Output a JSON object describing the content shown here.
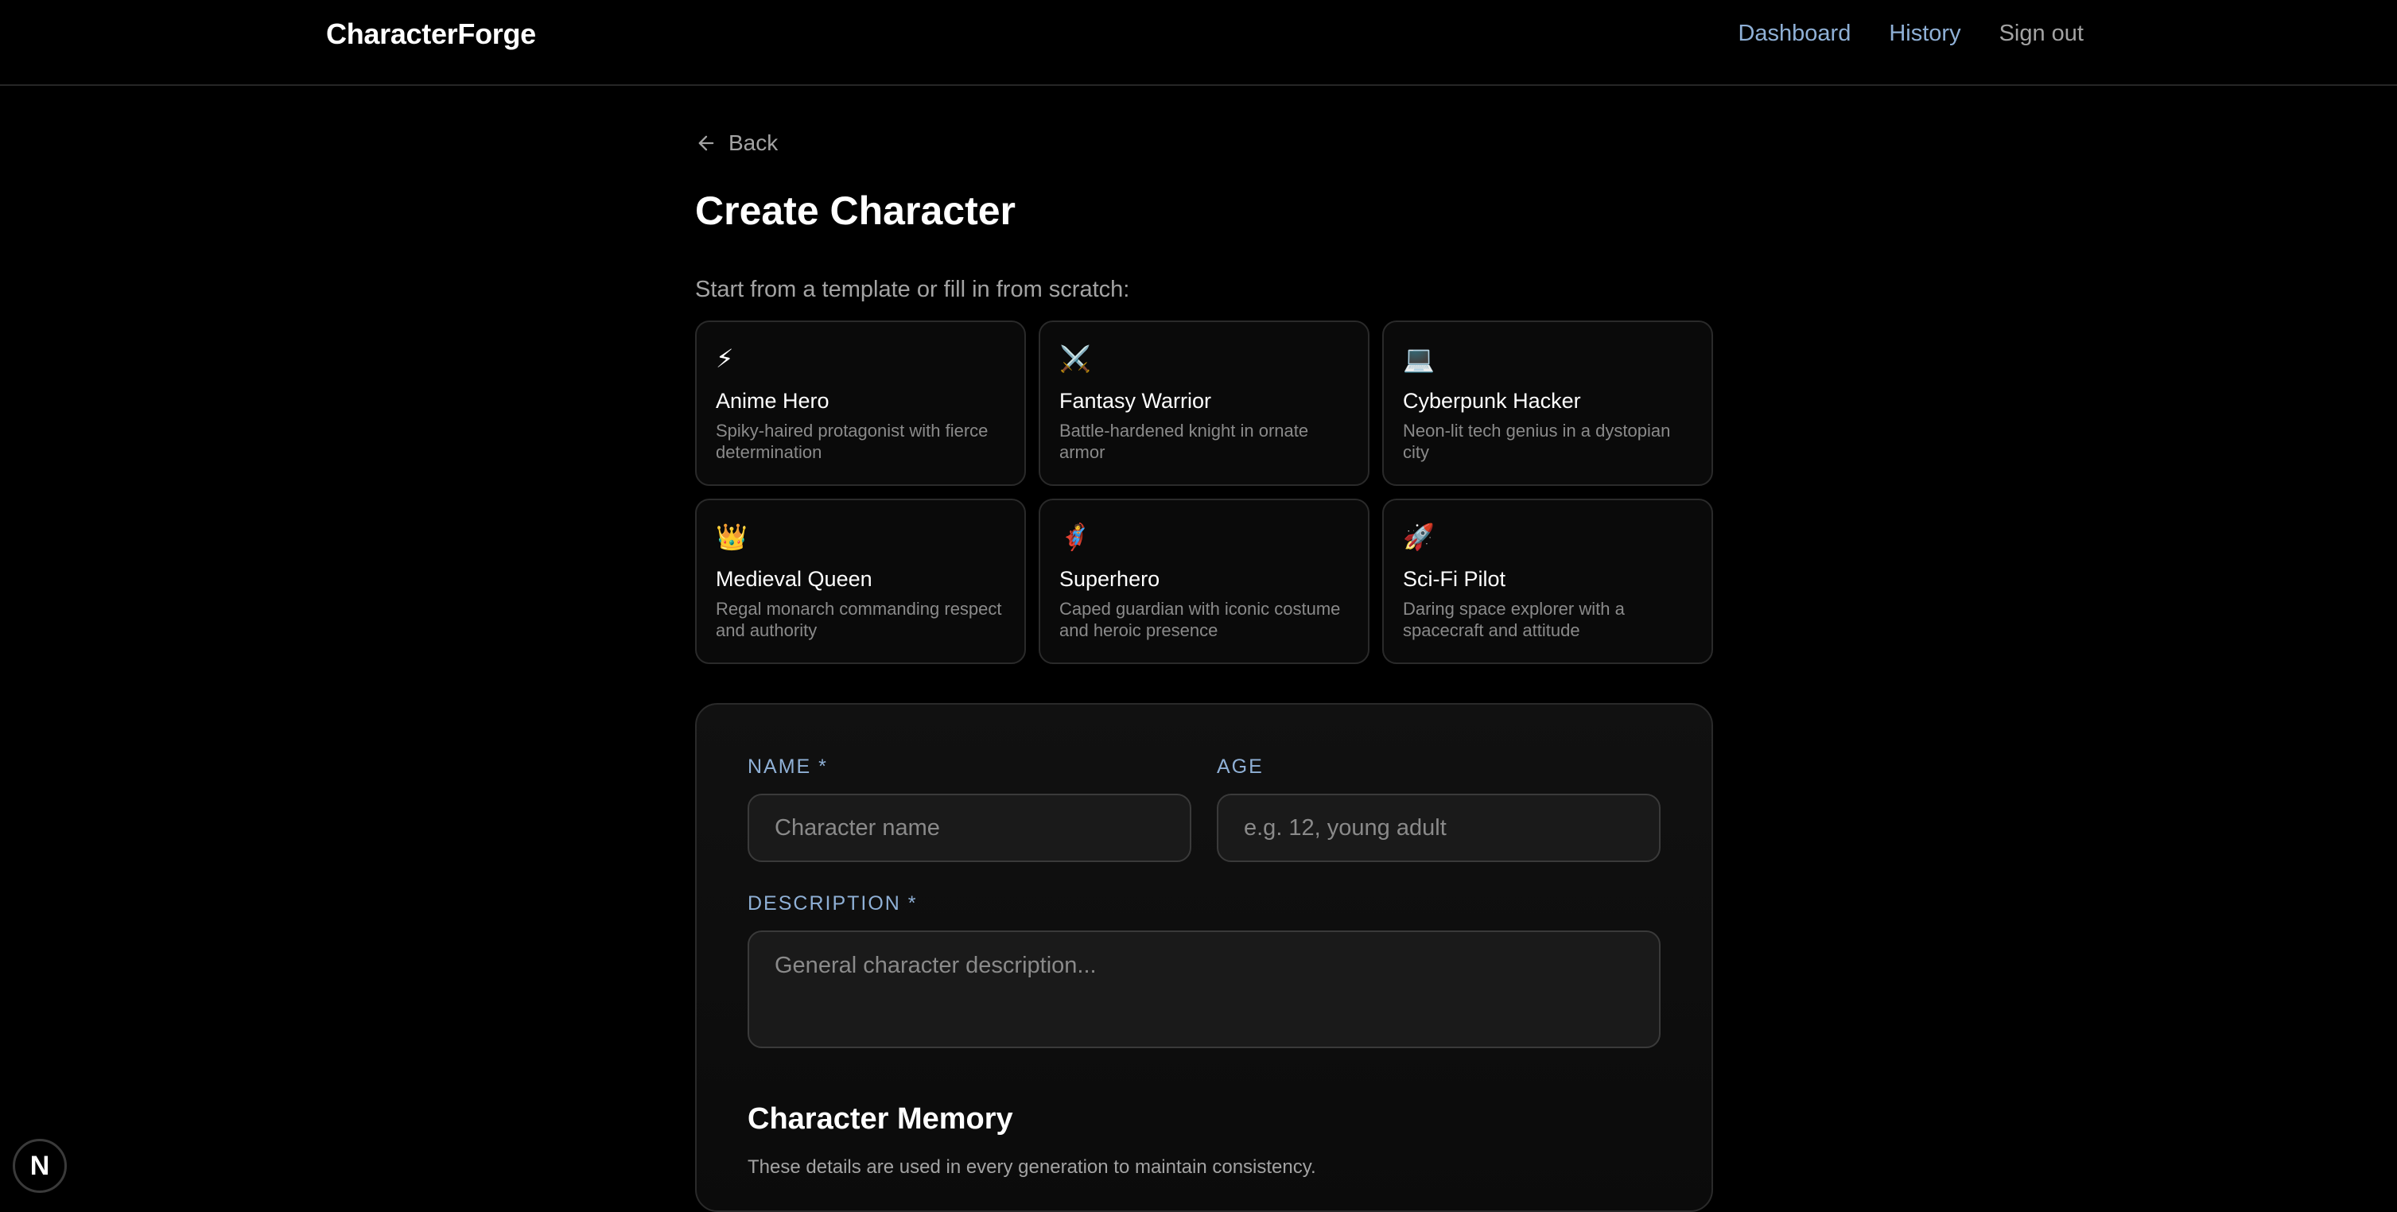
{
  "header": {
    "brand": "CharacterForge",
    "nav": [
      "Dashboard",
      "History",
      "Sign out"
    ]
  },
  "page": {
    "back_label": "Back",
    "title": "Create Character",
    "template_prompt": "Start from a template or fill in from scratch:"
  },
  "templates": [
    {
      "icon": "⚡",
      "icon_name": "lightning-icon",
      "name": "Anime Hero",
      "desc": "Spiky-haired protagonist with fierce determination"
    },
    {
      "icon": "⚔️",
      "icon_name": "crossed-swords-icon",
      "name": "Fantasy Warrior",
      "desc": "Battle-hardened knight in ornate armor"
    },
    {
      "icon": "💻",
      "icon_name": "laptop-icon",
      "name": "Cyberpunk Hacker",
      "desc": "Neon-lit tech genius in a dystopian city"
    },
    {
      "icon": "👑",
      "icon_name": "crown-icon",
      "name": "Medieval Queen",
      "desc": "Regal monarch commanding respect and authority"
    },
    {
      "icon": "🦸",
      "icon_name": "superhero-icon",
      "name": "Superhero",
      "desc": "Caped guardian with iconic costume and heroic presence"
    },
    {
      "icon": "🚀",
      "icon_name": "rocket-icon",
      "name": "Sci-Fi Pilot",
      "desc": "Daring space explorer with a spacecraft and attitude"
    }
  ],
  "form": {
    "name_label": "NAME *",
    "name_placeholder": "Character name",
    "name_value": "",
    "age_label": "AGE",
    "age_placeholder": "e.g. 12, young adult",
    "age_value": "",
    "description_label": "DESCRIPTION *",
    "description_placeholder": "General character description...",
    "description_value": "",
    "memory_title": "Character Memory",
    "memory_subtitle": "These details are used in every generation to maintain consistency."
  },
  "dev_badge": "N",
  "colors": {
    "accent_blue": "#8fb0d6",
    "muted_text": "#a3a3a3",
    "background": "#000000",
    "card_border": "#2a2a2a"
  }
}
